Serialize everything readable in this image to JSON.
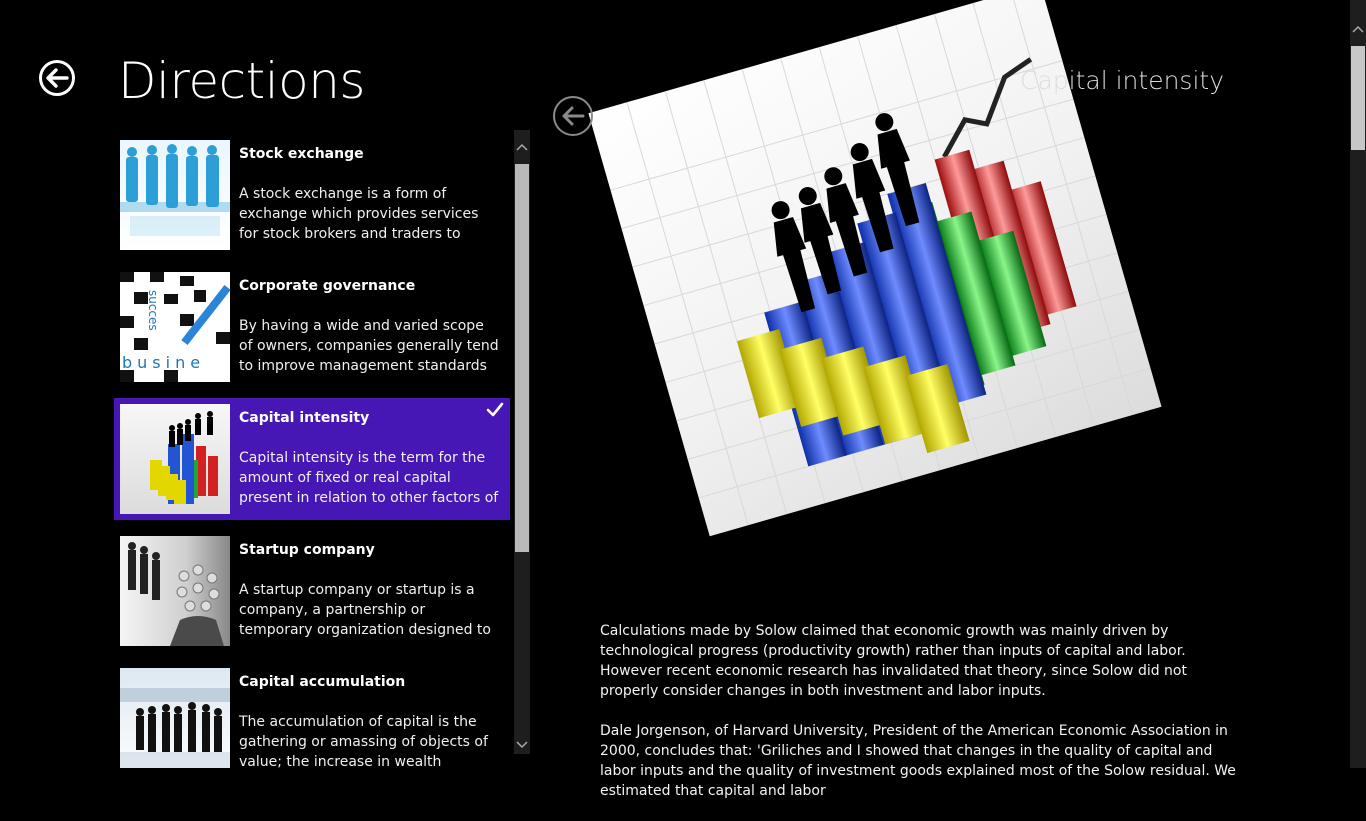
{
  "header": {
    "title": "Directions"
  },
  "list": {
    "items": [
      {
        "title": "Stock exchange",
        "desc": "A stock exchange is a form of exchange which provides services for stock brokers and traders to trade stocks, bonds, and..."
      },
      {
        "title": "Corporate governance",
        "desc": "By having a wide and varied scope of owners, companies generally tend to improve management standards and..."
      },
      {
        "title": "Capital intensity",
        "desc": "Capital intensity is the term for the amount of fixed or real capital present in relation to other factors of production,...",
        "selected": true
      },
      {
        "title": "Startup company",
        "desc": "A startup company or startup is a company, a partnership or temporary organization designed to search for a..."
      },
      {
        "title": "Capital accumulation",
        "desc": "The accumulation of capital is the gathering or amassing of objects of value; the increase in wealth through..."
      }
    ]
  },
  "thumb_text": {
    "word_down": "succes",
    "word_across": "busine"
  },
  "detail": {
    "title": "Capital intensity",
    "paragraphs": [
      "Calculations made by Solow claimed that economic growth was mainly driven by technological progress (productivity growth) rather than inputs of capital and labor. However recent economic research has invalidated that theory, since Solow did not properly consider changes in both investment and labor inputs.",
      "Dale Jorgenson, of Harvard University, President of the American Economic Association in 2000, concludes that: 'Griliches and I showed that changes in the quality of capital and labor inputs and the quality of investment goods explained most of the Solow residual. We estimated that capital and labor"
    ]
  },
  "colors": {
    "selected": "#4617b4",
    "background": "#000000"
  }
}
